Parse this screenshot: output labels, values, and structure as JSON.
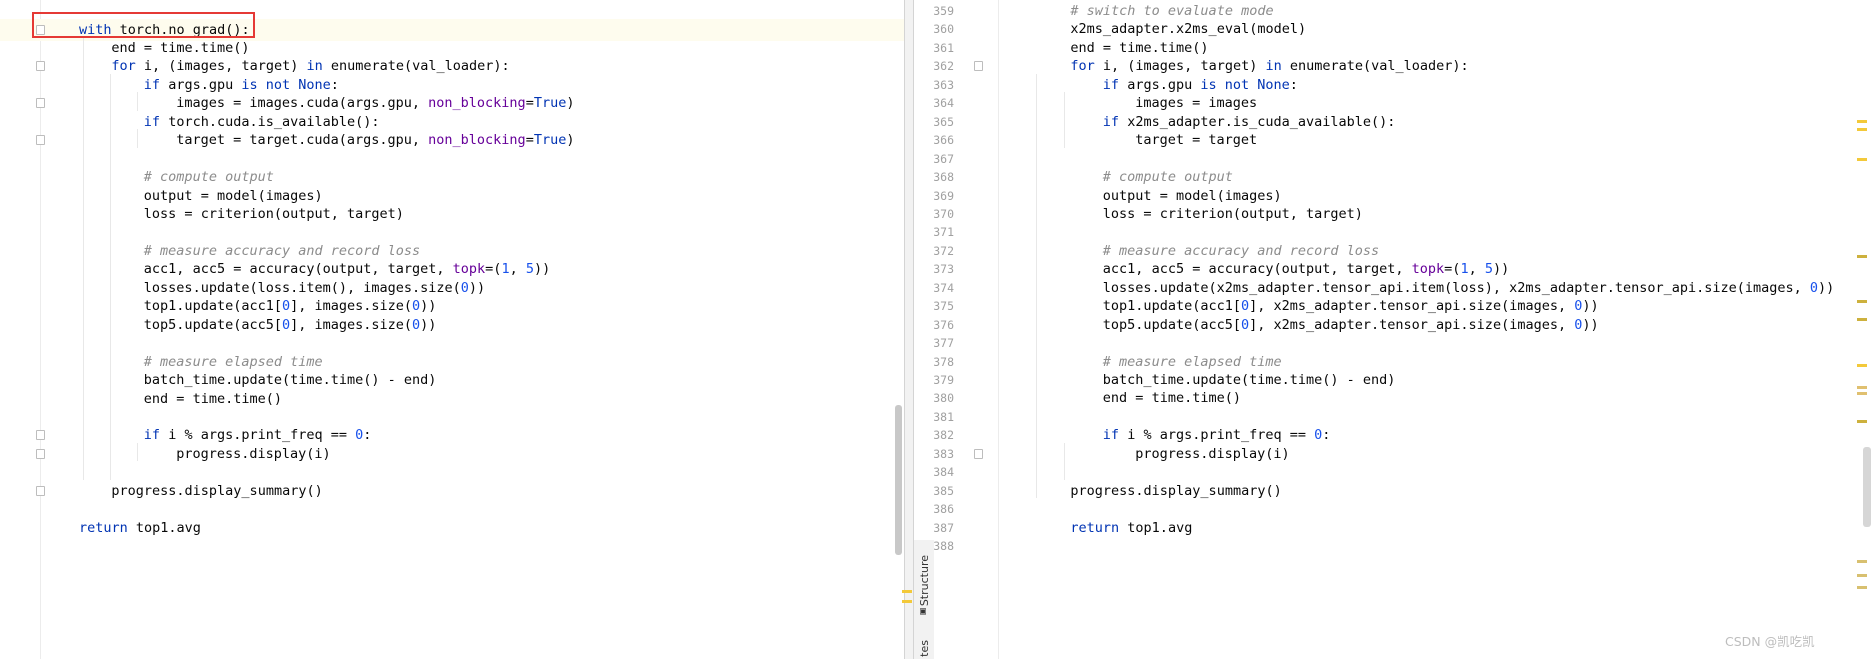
{
  "left": {
    "top_line": 1,
    "highlight_line": 0,
    "lines": [
      {
        "n": "",
        "c": [
          {
            "t": "with",
            "s": "kw"
          },
          {
            "t": " torch.no_grad():"
          }
        ]
      },
      {
        "n": "",
        "c": [
          {
            "t": "end = time.time()"
          }
        ]
      },
      {
        "n": "",
        "c": [
          {
            "t": "for",
            "s": "kw"
          },
          {
            "t": " i, (images, target) "
          },
          {
            "t": "in",
            "s": "kw"
          },
          {
            "t": " enumerate(val_loader):"
          }
        ]
      },
      {
        "n": "",
        "c": [
          {
            "t": "if",
            "s": "kw"
          },
          {
            "t": " args.gpu "
          },
          {
            "t": "is not None",
            "s": "kw"
          },
          {
            "t": ":"
          }
        ]
      },
      {
        "n": "",
        "c": [
          {
            "t": "images = images.cuda(args.gpu, "
          },
          {
            "t": "non_blocking",
            "s": "pa"
          },
          {
            "t": "="
          },
          {
            "t": "True",
            "s": "kw"
          },
          {
            "t": ")"
          }
        ]
      },
      {
        "n": "",
        "c": [
          {
            "t": "if",
            "s": "kw"
          },
          {
            "t": " torch.cuda.is_available():"
          }
        ]
      },
      {
        "n": "",
        "c": [
          {
            "t": "target = target.cuda(args.gpu, "
          },
          {
            "t": "non_blocking",
            "s": "pa"
          },
          {
            "t": "="
          },
          {
            "t": "True",
            "s": "kw"
          },
          {
            "t": ")"
          }
        ]
      },
      {
        "n": "",
        "c": []
      },
      {
        "n": "",
        "c": [
          {
            "t": "# compute output",
            "s": "cm"
          }
        ]
      },
      {
        "n": "",
        "c": [
          {
            "t": "output = model(images)"
          }
        ]
      },
      {
        "n": "",
        "c": [
          {
            "t": "loss = criterion(output, target)"
          }
        ]
      },
      {
        "n": "",
        "c": []
      },
      {
        "n": "",
        "c": [
          {
            "t": "# measure accuracy and record loss",
            "s": "cm"
          }
        ]
      },
      {
        "n": "",
        "c": [
          {
            "t": "acc1, acc5 = accuracy(output, target, "
          },
          {
            "t": "topk",
            "s": "pa"
          },
          {
            "t": "=("
          },
          {
            "t": "1",
            "s": "nm"
          },
          {
            "t": ", "
          },
          {
            "t": "5",
            "s": "nm"
          },
          {
            "t": "))"
          }
        ]
      },
      {
        "n": "",
        "c": [
          {
            "t": "losses.update(loss.item(), images.size("
          },
          {
            "t": "0",
            "s": "nm"
          },
          {
            "t": "))"
          }
        ]
      },
      {
        "n": "",
        "c": [
          {
            "t": "top1.update(acc1["
          },
          {
            "t": "0",
            "s": "nm"
          },
          {
            "t": "], images.size("
          },
          {
            "t": "0",
            "s": "nm"
          },
          {
            "t": "))"
          }
        ]
      },
      {
        "n": "",
        "c": [
          {
            "t": "top5.update(acc5["
          },
          {
            "t": "0",
            "s": "nm"
          },
          {
            "t": "], images.size("
          },
          {
            "t": "0",
            "s": "nm"
          },
          {
            "t": "))"
          }
        ]
      },
      {
        "n": "",
        "c": []
      },
      {
        "n": "",
        "c": [
          {
            "t": "# measure elapsed time",
            "s": "cm"
          }
        ]
      },
      {
        "n": "",
        "c": [
          {
            "t": "batch_time.update(time.time() - end)"
          }
        ]
      },
      {
        "n": "",
        "c": [
          {
            "t": "end = time.time()"
          }
        ]
      },
      {
        "n": "",
        "c": []
      },
      {
        "n": "",
        "c": [
          {
            "t": "if",
            "s": "kw"
          },
          {
            "t": " i % args.print_freq == "
          },
          {
            "t": "0",
            "s": "nm"
          },
          {
            "t": ":"
          }
        ]
      },
      {
        "n": "",
        "c": [
          {
            "t": "progress.display(i)"
          }
        ]
      },
      {
        "n": "",
        "c": []
      },
      {
        "n": "",
        "c": [
          {
            "t": "progress.display_summary()"
          }
        ]
      },
      {
        "n": "",
        "c": []
      },
      {
        "n": "",
        "c": [
          {
            "t": "return",
            "s": "kw"
          },
          {
            "t": " top1.avg"
          }
        ]
      },
      {
        "n": "",
        "c": []
      }
    ]
  },
  "right": {
    "lines": [
      {
        "n": "359",
        "c": [
          {
            "t": "# switch to evaluate mode",
            "s": "cm"
          }
        ]
      },
      {
        "n": "360",
        "c": [
          {
            "t": "x2ms_adapter.x2ms_eval(model)"
          }
        ]
      },
      {
        "n": "361",
        "c": [
          {
            "t": "end = time.time()"
          }
        ]
      },
      {
        "n": "362",
        "c": [
          {
            "t": "for",
            "s": "kw"
          },
          {
            "t": " i, (images, target) "
          },
          {
            "t": "in",
            "s": "kw"
          },
          {
            "t": " enumerate(val_loader):"
          }
        ]
      },
      {
        "n": "363",
        "c": [
          {
            "t": "if",
            "s": "kw"
          },
          {
            "t": " args.gpu "
          },
          {
            "t": "is not None",
            "s": "kw"
          },
          {
            "t": ":"
          }
        ]
      },
      {
        "n": "364",
        "c": [
          {
            "t": "images = images"
          }
        ]
      },
      {
        "n": "365",
        "c": [
          {
            "t": "if",
            "s": "kw"
          },
          {
            "t": " x2ms_adapter.is_cuda_available():"
          }
        ]
      },
      {
        "n": "366",
        "c": [
          {
            "t": "target = target"
          }
        ]
      },
      {
        "n": "367",
        "c": []
      },
      {
        "n": "368",
        "c": [
          {
            "t": "# compute output",
            "s": "cm"
          }
        ]
      },
      {
        "n": "369",
        "c": [
          {
            "t": "output = model(images)"
          }
        ]
      },
      {
        "n": "370",
        "c": [
          {
            "t": "loss = criterion(output, target)"
          }
        ]
      },
      {
        "n": "371",
        "c": []
      },
      {
        "n": "372",
        "c": [
          {
            "t": "# measure accuracy and record loss",
            "s": "cm"
          }
        ]
      },
      {
        "n": "373",
        "c": [
          {
            "t": "acc1, acc5 = accuracy(output, target, "
          },
          {
            "t": "topk",
            "s": "pa"
          },
          {
            "t": "=("
          },
          {
            "t": "1",
            "s": "nm"
          },
          {
            "t": ", "
          },
          {
            "t": "5",
            "s": "nm"
          },
          {
            "t": "))"
          }
        ]
      },
      {
        "n": "374",
        "c": [
          {
            "t": "losses.update(x2ms_adapter.tensor_api.item(loss), x2ms_adapter.tensor_api.size(images, "
          },
          {
            "t": "0",
            "s": "nm"
          },
          {
            "t": "))"
          }
        ]
      },
      {
        "n": "375",
        "c": [
          {
            "t": "top1.update(acc1["
          },
          {
            "t": "0",
            "s": "nm"
          },
          {
            "t": "], x2ms_adapter.tensor_api.size(images, "
          },
          {
            "t": "0",
            "s": "nm"
          },
          {
            "t": "))"
          }
        ]
      },
      {
        "n": "376",
        "c": [
          {
            "t": "top5.update(acc5["
          },
          {
            "t": "0",
            "s": "nm"
          },
          {
            "t": "], x2ms_adapter.tensor_api.size(images, "
          },
          {
            "t": "0",
            "s": "nm"
          },
          {
            "t": "))"
          }
        ]
      },
      {
        "n": "377",
        "c": []
      },
      {
        "n": "378",
        "c": [
          {
            "t": "# measure elapsed time",
            "s": "cm"
          }
        ]
      },
      {
        "n": "379",
        "c": [
          {
            "t": "batch_time.update(time.time() - end)"
          }
        ]
      },
      {
        "n": "380",
        "c": [
          {
            "t": "end = time.time()"
          }
        ]
      },
      {
        "n": "381",
        "c": []
      },
      {
        "n": "382",
        "c": [
          {
            "t": "if",
            "s": "kw"
          },
          {
            "t": " i % args.print_freq == "
          },
          {
            "t": "0",
            "s": "nm"
          },
          {
            "t": ":"
          }
        ]
      },
      {
        "n": "383",
        "c": [
          {
            "t": "progress.display(i)"
          }
        ]
      },
      {
        "n": "384",
        "c": []
      },
      {
        "n": "385",
        "c": [
          {
            "t": "progress.display_summary()"
          }
        ]
      },
      {
        "n": "386",
        "c": []
      },
      {
        "n": "387",
        "c": [
          {
            "t": "return",
            "s": "kw"
          },
          {
            "t": " top1.avg"
          }
        ]
      },
      {
        "n": "388",
        "c": []
      }
    ]
  },
  "tool_window": {
    "structure_label": "Structure",
    "partial_label": "tes",
    "structure_icon": "structure-icon"
  },
  "watermark": "CSDN @凯吃凯",
  "colors": {
    "keyword": "#0033b3",
    "comment": "#8c8c8c",
    "number": "#1750eb",
    "param": "#660099",
    "highlight_box": "#e53935",
    "current_line": "#fefcee"
  }
}
